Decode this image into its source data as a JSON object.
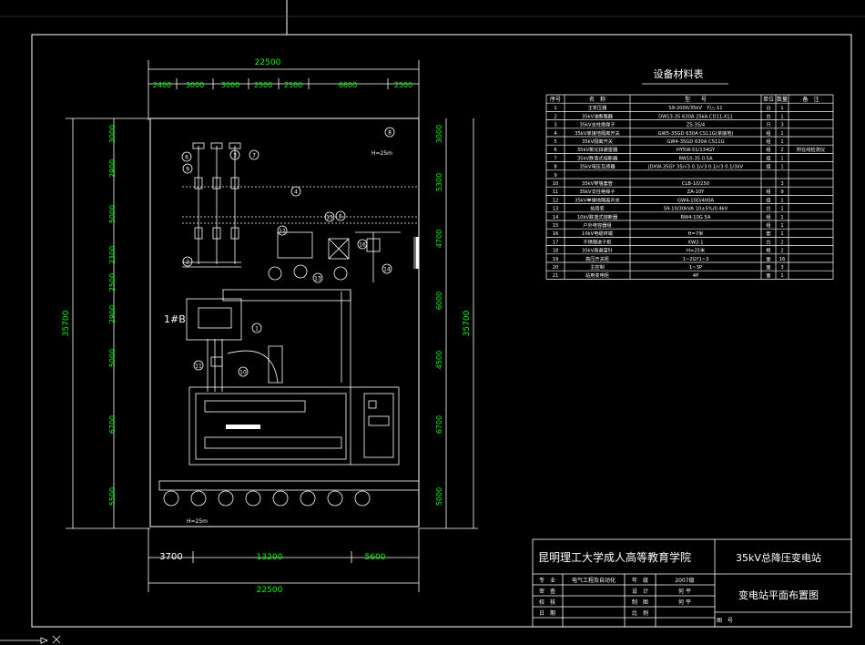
{
  "table": {
    "title": "设备材料表",
    "headers": [
      "序号",
      "名　称",
      "型　　号",
      "单位",
      "数量",
      "备　注"
    ],
    "rows": [
      [
        "1",
        "主变压器",
        "S9-2000/35kV　Y/△-11",
        "台",
        "1",
        ""
      ],
      [
        "2",
        "35kV油断路器",
        "DW13-35 630A 25kA CD11-X11",
        "台",
        "1",
        ""
      ],
      [
        "3",
        "35kV支柱绝缘子",
        "ZS-35/4",
        "只",
        "3",
        ""
      ],
      [
        "4",
        "35kV单接地隔离开关",
        "GW5-35GD 630A CS11G(单接地)",
        "组",
        "1",
        ""
      ],
      [
        "5",
        "35kV隔离开关",
        "GW4-35GD 630A CS11G",
        "组",
        "1",
        ""
      ],
      [
        "6",
        "35kV氧化锌避雷器",
        "HY5W-51/134GY",
        "组",
        "2",
        "附在线检测仪"
      ],
      [
        "7",
        "35kV跌落式熔断器",
        "RW10-35 0.5A",
        "组",
        "1",
        ""
      ],
      [
        "8",
        "35kV电压互感器",
        "JDXW-35GY 35/√3 0.1/√3 0.1/√3 0.1/3kV",
        "组",
        "1",
        ""
      ],
      [
        "9",
        "",
        "",
        "",
        "",
        ""
      ],
      [
        "10",
        "35kV穿墙套管",
        "CLB-10/250",
        "",
        "3",
        ""
      ],
      [
        "11",
        "35kV支柱绝缘子",
        "ZA-10Y",
        "组",
        "9",
        ""
      ],
      [
        "12",
        "35kV单接地隔离开关",
        "GW4-10D/400A",
        "组",
        "1",
        ""
      ],
      [
        "13",
        "站用变",
        "S9-10/30kVA 10±5%/0.4kV",
        "台",
        "1",
        ""
      ],
      [
        "14",
        "10kV跌落式熔断器",
        "RW4-10G 5A",
        "组",
        "1",
        ""
      ],
      [
        "15",
        "户外电容器组",
        "",
        "组",
        "1",
        ""
      ],
      [
        "16",
        "10kV电缆终端",
        "H=7米",
        "套",
        "1",
        ""
      ],
      [
        "17",
        "不锈钢进子柜",
        "XW2-1",
        "台",
        "2",
        ""
      ],
      [
        "18",
        "35kV高避雷针",
        "H=25米",
        "根",
        "2",
        ""
      ],
      [
        "19",
        "高压开关柜",
        "1~2GY1~3",
        "面",
        "16",
        ""
      ],
      [
        "20",
        "主控制",
        "1~3P",
        "面",
        "3",
        ""
      ],
      [
        "21",
        "站用变电柜",
        "4P",
        "面",
        "1",
        ""
      ]
    ]
  },
  "dimensions": {
    "top_total": "22500",
    "top_parts": [
      "2400",
      "3000",
      "3000",
      "2500",
      "2500",
      "6600",
      "2500"
    ],
    "bottom_parts": [
      "3700",
      "13200",
      "5600"
    ],
    "bottom_total": "22500",
    "left_parts": [
      "3000",
      "2900",
      "5000",
      "2300",
      "2500",
      "2900",
      "5000",
      "6700",
      "5500"
    ],
    "left_total": "35700",
    "right_parts": [
      "3000",
      "5300",
      "4700",
      "6000",
      "4500",
      "6700",
      "5000"
    ],
    "right_total": "35700"
  },
  "plan": {
    "transformer_label": "1#B",
    "callouts": [
      "1",
      "2",
      "3",
      "4",
      "5",
      "6",
      "7",
      "8",
      "9",
      "10",
      "11",
      "12",
      "13",
      "14",
      "15",
      "16"
    ],
    "height_mark": "H=25m"
  },
  "title_block": {
    "school": "昆明理工大学成人高等教育学院",
    "project": "35kV总降压变电站",
    "drawing_name": "变电站平面布置图",
    "fields": [
      {
        "label": "专　业",
        "value": "电气工程及自动化"
      },
      {
        "label": "年　级",
        "value": "2007级"
      },
      {
        "label": "审　查",
        "value": ""
      },
      {
        "label": "设　计",
        "value": "何 平"
      },
      {
        "label": "校　核",
        "value": ""
      },
      {
        "label": "制　图",
        "value": "何 平"
      },
      {
        "label": "日　期",
        "value": ""
      },
      {
        "label": "比　例",
        "value": ""
      },
      {
        "label": "图　号",
        "value": ""
      }
    ]
  },
  "colors": {
    "background": "#000000",
    "lines": "#ffffff",
    "dimension_text": "#00ff00",
    "frame": "#ffffff"
  }
}
